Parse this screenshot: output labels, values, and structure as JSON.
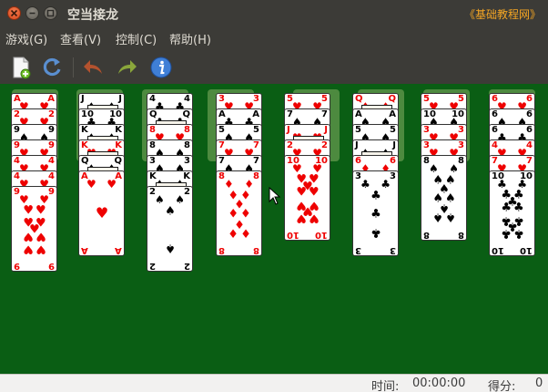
{
  "window": {
    "title": "空当接龙",
    "watermark": "《基础教程网》",
    "close_icon": "close-icon",
    "minimize_icon": "minimize-icon",
    "maximize_icon": "maximize-icon"
  },
  "menu": {
    "items": [
      {
        "label": "游戏(G)"
      },
      {
        "label": "查看(V)"
      },
      {
        "label": "控制(C)"
      },
      {
        "label": "帮助(H)"
      }
    ]
  },
  "toolbar": {
    "tools": [
      {
        "name": "new-game",
        "icon": "new-document-icon"
      },
      {
        "name": "restart",
        "icon": "refresh-icon"
      },
      {
        "name": "undo",
        "icon": "undo-arrow-icon"
      },
      {
        "name": "redo",
        "icon": "redo-arrow-icon"
      },
      {
        "name": "info",
        "icon": "info-icon"
      }
    ]
  },
  "board": {
    "background": "#0a5e14",
    "slot_color": "#4d8a3f",
    "free_cells": 4,
    "foundations": 4,
    "columns": [
      {
        "cards": [
          "A♥",
          "2♥",
          "9♠",
          "9♥",
          "4♥",
          "4♥",
          "9♥"
        ]
      },
      {
        "cards": [
          "J♠",
          "10♣",
          "K♠",
          "K♥",
          "Q♠",
          "A♥"
        ]
      },
      {
        "cards": [
          "4♣",
          "Q♣",
          "8♥",
          "8♠",
          "3♠",
          "K♠",
          "2♠"
        ]
      },
      {
        "cards": [
          "3♥",
          "A♣",
          "5♠",
          "7♥",
          "7♠",
          "8♦"
        ]
      },
      {
        "cards": [
          "5♥",
          "7♠",
          "J♥",
          "2♥",
          "10♥"
        ]
      },
      {
        "cards": [
          "Q♦",
          "A♠",
          "5♠",
          "J♠",
          "6♦",
          "3♣"
        ]
      },
      {
        "cards": [
          "5♥",
          "10♠",
          "3♥",
          "3♥",
          "8♠"
        ]
      },
      {
        "cards": [
          "6♥",
          "6♠",
          "6♣",
          "4♥",
          "7♥",
          "10♣"
        ]
      }
    ]
  },
  "status": {
    "time_label": "时间:",
    "time_value": "00:00:00",
    "score_label": "得分:",
    "score_value": "0"
  }
}
